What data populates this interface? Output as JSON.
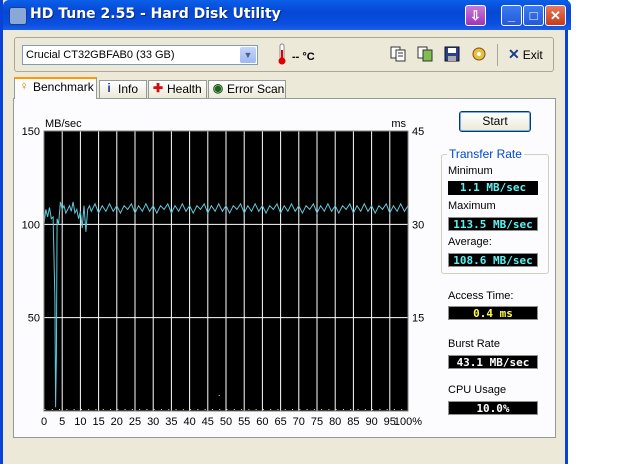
{
  "window": {
    "title": "HD Tune 2.55 - Hard Disk Utility",
    "buttons": {
      "minimize": "_",
      "maximize": "□",
      "close": "✕"
    }
  },
  "toolbar": {
    "drive": "Crucial CT32GBFAB0 (33 GB)",
    "temperature": "-- °C",
    "exit_label": "Exit",
    "icons": [
      "copy-text-icon",
      "copy-screen-icon",
      "save-icon",
      "options-icon"
    ]
  },
  "tabs": [
    {
      "label": "Benchmark",
      "icon": "bulb-icon",
      "active": true
    },
    {
      "label": "Info",
      "icon": "info-icon",
      "active": false
    },
    {
      "label": "Health",
      "icon": "health-cross-icon",
      "active": false
    },
    {
      "label": "Error Scan",
      "icon": "magnifier-icon",
      "active": false
    }
  ],
  "benchmark": {
    "start_label": "Start",
    "transfer_rate_title": "Transfer Rate",
    "minimum_label": "Minimum",
    "minimum_value": "1.1 MB/sec",
    "maximum_label": "Maximum",
    "maximum_value": "113.5 MB/sec",
    "average_label": "Average:",
    "average_value": "108.6 MB/sec",
    "access_time_label": "Access Time:",
    "access_time_value": "0.4 ms",
    "burst_rate_label": "Burst Rate",
    "burst_rate_value": "43.1 MB/sec",
    "cpu_usage_label": "CPU Usage",
    "cpu_usage_value": "10.0%"
  },
  "colors": {
    "graph_bg": "#000000",
    "grid": "#ffffff",
    "transfer_line": "#5fc8d8",
    "access_points": "#e8e860"
  },
  "chart_data": {
    "type": "line",
    "ylabel_left": "MB/sec",
    "ylabel_right": "ms",
    "x_ticks": [
      "0",
      "5",
      "10",
      "15",
      "20",
      "25",
      "30",
      "35",
      "40",
      "45",
      "50",
      "55",
      "60",
      "65",
      "70",
      "75",
      "80",
      "85",
      "90",
      "95",
      "100%"
    ],
    "y_left_ticks": [
      "150",
      "100",
      "50"
    ],
    "y_right_ticks": [
      "45",
      "30",
      "15"
    ],
    "xlim": [
      0,
      100
    ],
    "ylim_left": [
      0,
      150
    ],
    "ylim_right": [
      0,
      45
    ],
    "grid": true,
    "series": [
      {
        "x": [
          0,
          0.5,
          1,
          1.5,
          2,
          2.5,
          3,
          3.2,
          3.4,
          3.6,
          4,
          4.5,
          5,
          5.5,
          6,
          6.5,
          7,
          7.5,
          8,
          8.5,
          9,
          9.5,
          10,
          10.5,
          11,
          11.5,
          12,
          12.5,
          13,
          14,
          15,
          16,
          17,
          18,
          19,
          20,
          21,
          22,
          23,
          24,
          25,
          26,
          27,
          28,
          29,
          30,
          31,
          32,
          33,
          34,
          35,
          36,
          37,
          38,
          39,
          40,
          41,
          42,
          43,
          44,
          45,
          46,
          47,
          48,
          49,
          50,
          51,
          52,
          53,
          54,
          55,
          56,
          57,
          58,
          59,
          60,
          61,
          62,
          63,
          64,
          65,
          66,
          67,
          68,
          69,
          70,
          71,
          72,
          73,
          74,
          75,
          76,
          77,
          78,
          79,
          80,
          81,
          82,
          83,
          84,
          85,
          86,
          87,
          88,
          89,
          90,
          91,
          92,
          93,
          94,
          95,
          96,
          97,
          98,
          99,
          100
        ],
        "values": [
          100,
          108,
          104,
          109,
          103,
          104,
          60,
          2,
          30,
          103,
          100,
          112,
          108,
          110,
          106,
          108,
          110,
          107,
          112,
          106,
          108,
          103,
          107,
          98,
          110,
          96,
          108,
          110,
          107,
          111,
          106,
          110,
          107,
          111,
          107,
          110,
          106,
          110,
          108,
          111,
          106,
          110,
          107,
          111,
          107,
          110,
          106,
          110,
          108,
          111,
          106,
          110,
          107,
          111,
          107,
          110,
          106,
          110,
          108,
          111,
          106,
          110,
          107,
          111,
          107,
          110,
          106,
          110,
          108,
          111,
          106,
          110,
          107,
          111,
          107,
          110,
          106,
          110,
          108,
          111,
          106,
          110,
          107,
          111,
          107,
          110,
          106,
          110,
          108,
          111,
          106,
          110,
          107,
          111,
          107,
          110,
          106,
          110,
          108,
          111,
          106,
          110,
          107,
          111,
          107,
          110,
          106,
          110,
          108,
          111,
          106,
          110,
          107,
          111,
          107,
          110
        ]
      }
    ]
  }
}
